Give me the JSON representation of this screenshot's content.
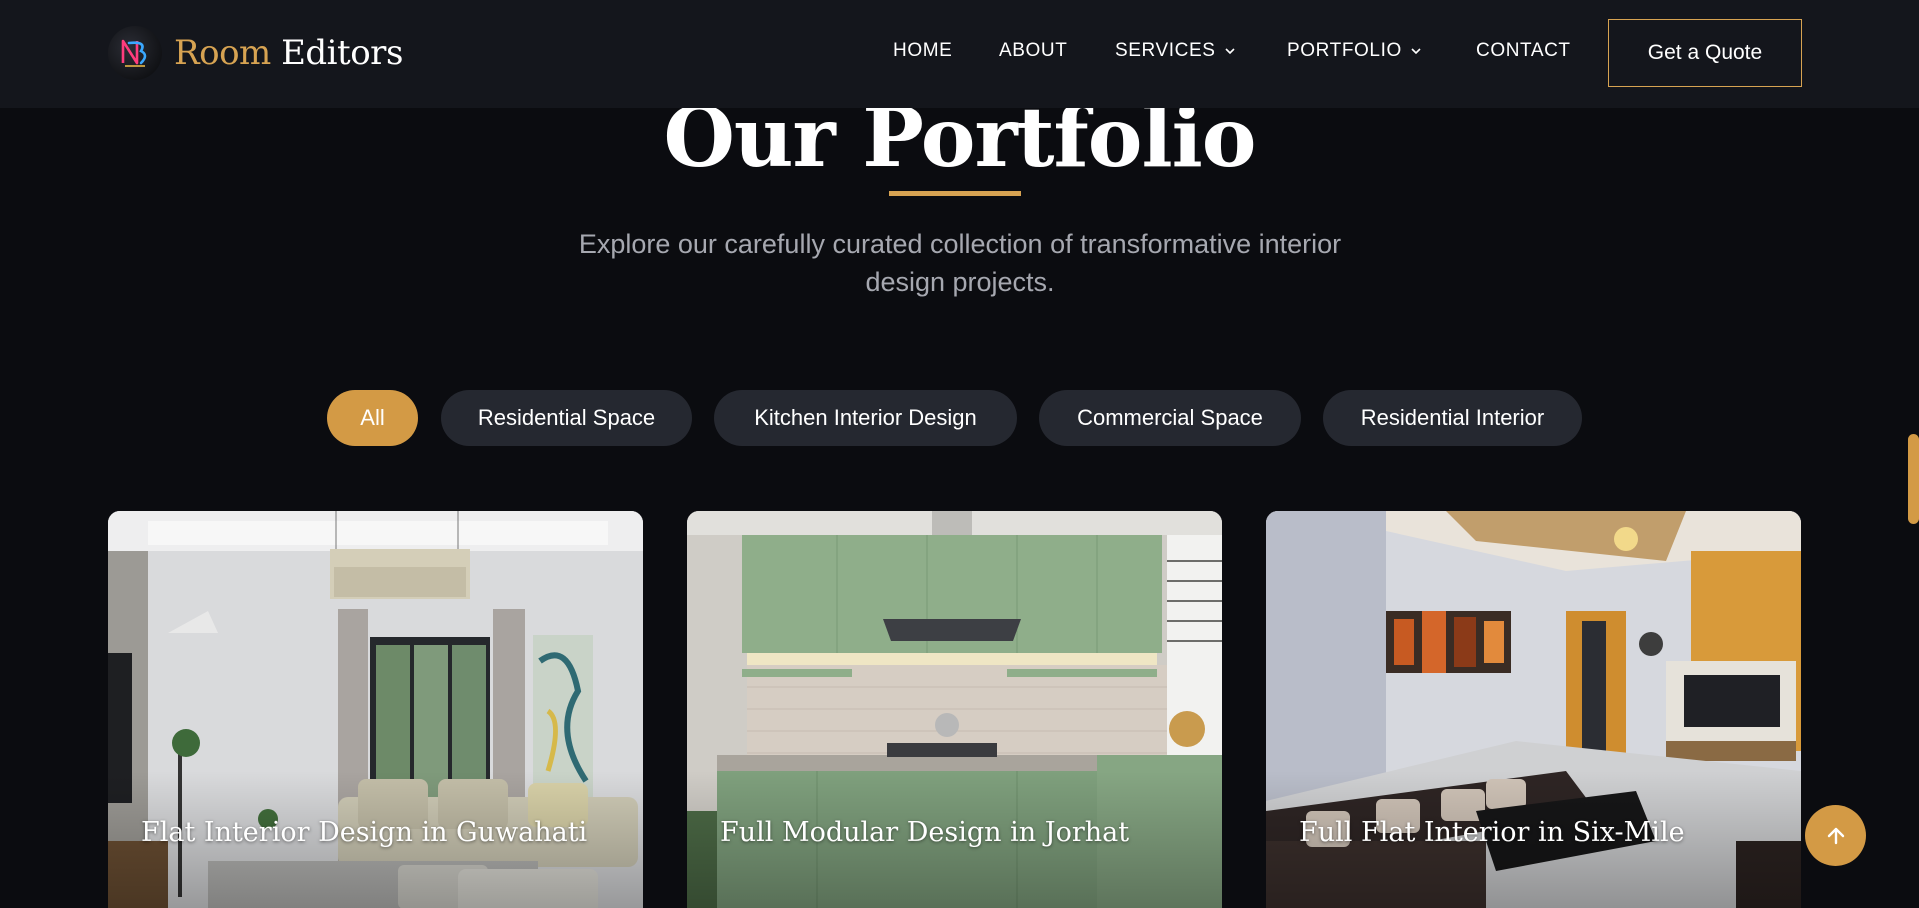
{
  "brand": {
    "word1": "Room",
    "word2": "Editors",
    "gold": "#d7a352"
  },
  "nav": {
    "items": [
      {
        "label": "HOME",
        "dropdown": false
      },
      {
        "label": "ABOUT",
        "dropdown": false
      },
      {
        "label": "SERVICES",
        "dropdown": true
      },
      {
        "label": "PORTFOLIO",
        "dropdown": true
      },
      {
        "label": "CONTACT",
        "dropdown": false
      }
    ],
    "cta": "Get a Quote"
  },
  "hero": {
    "title": "Our Portfolio",
    "subtitle_line1": "Explore our carefully curated collection of transformative interior",
    "subtitle_line2": "design projects."
  },
  "filters": [
    {
      "label": "All",
      "active": true
    },
    {
      "label": "Residential Space",
      "active": false
    },
    {
      "label": "Kitchen Interior Design",
      "active": false
    },
    {
      "label": "Commercial Space",
      "active": false
    },
    {
      "label": "Residential Interior",
      "active": false
    }
  ],
  "projects": [
    {
      "title": "Flat Interior Design in Guwahati"
    },
    {
      "title": "Full Modular Design in Jorhat"
    },
    {
      "title": "Full Flat Interior in Six-Mile"
    }
  ],
  "icons": {
    "back_to_top": "arrow-up-icon",
    "dropdown": "chevron-down-icon",
    "logo": "logo-icon"
  },
  "colors": {
    "accent": "#d39a45",
    "background": "#0b0c10",
    "header": "#14161c",
    "pill": "#252830"
  }
}
